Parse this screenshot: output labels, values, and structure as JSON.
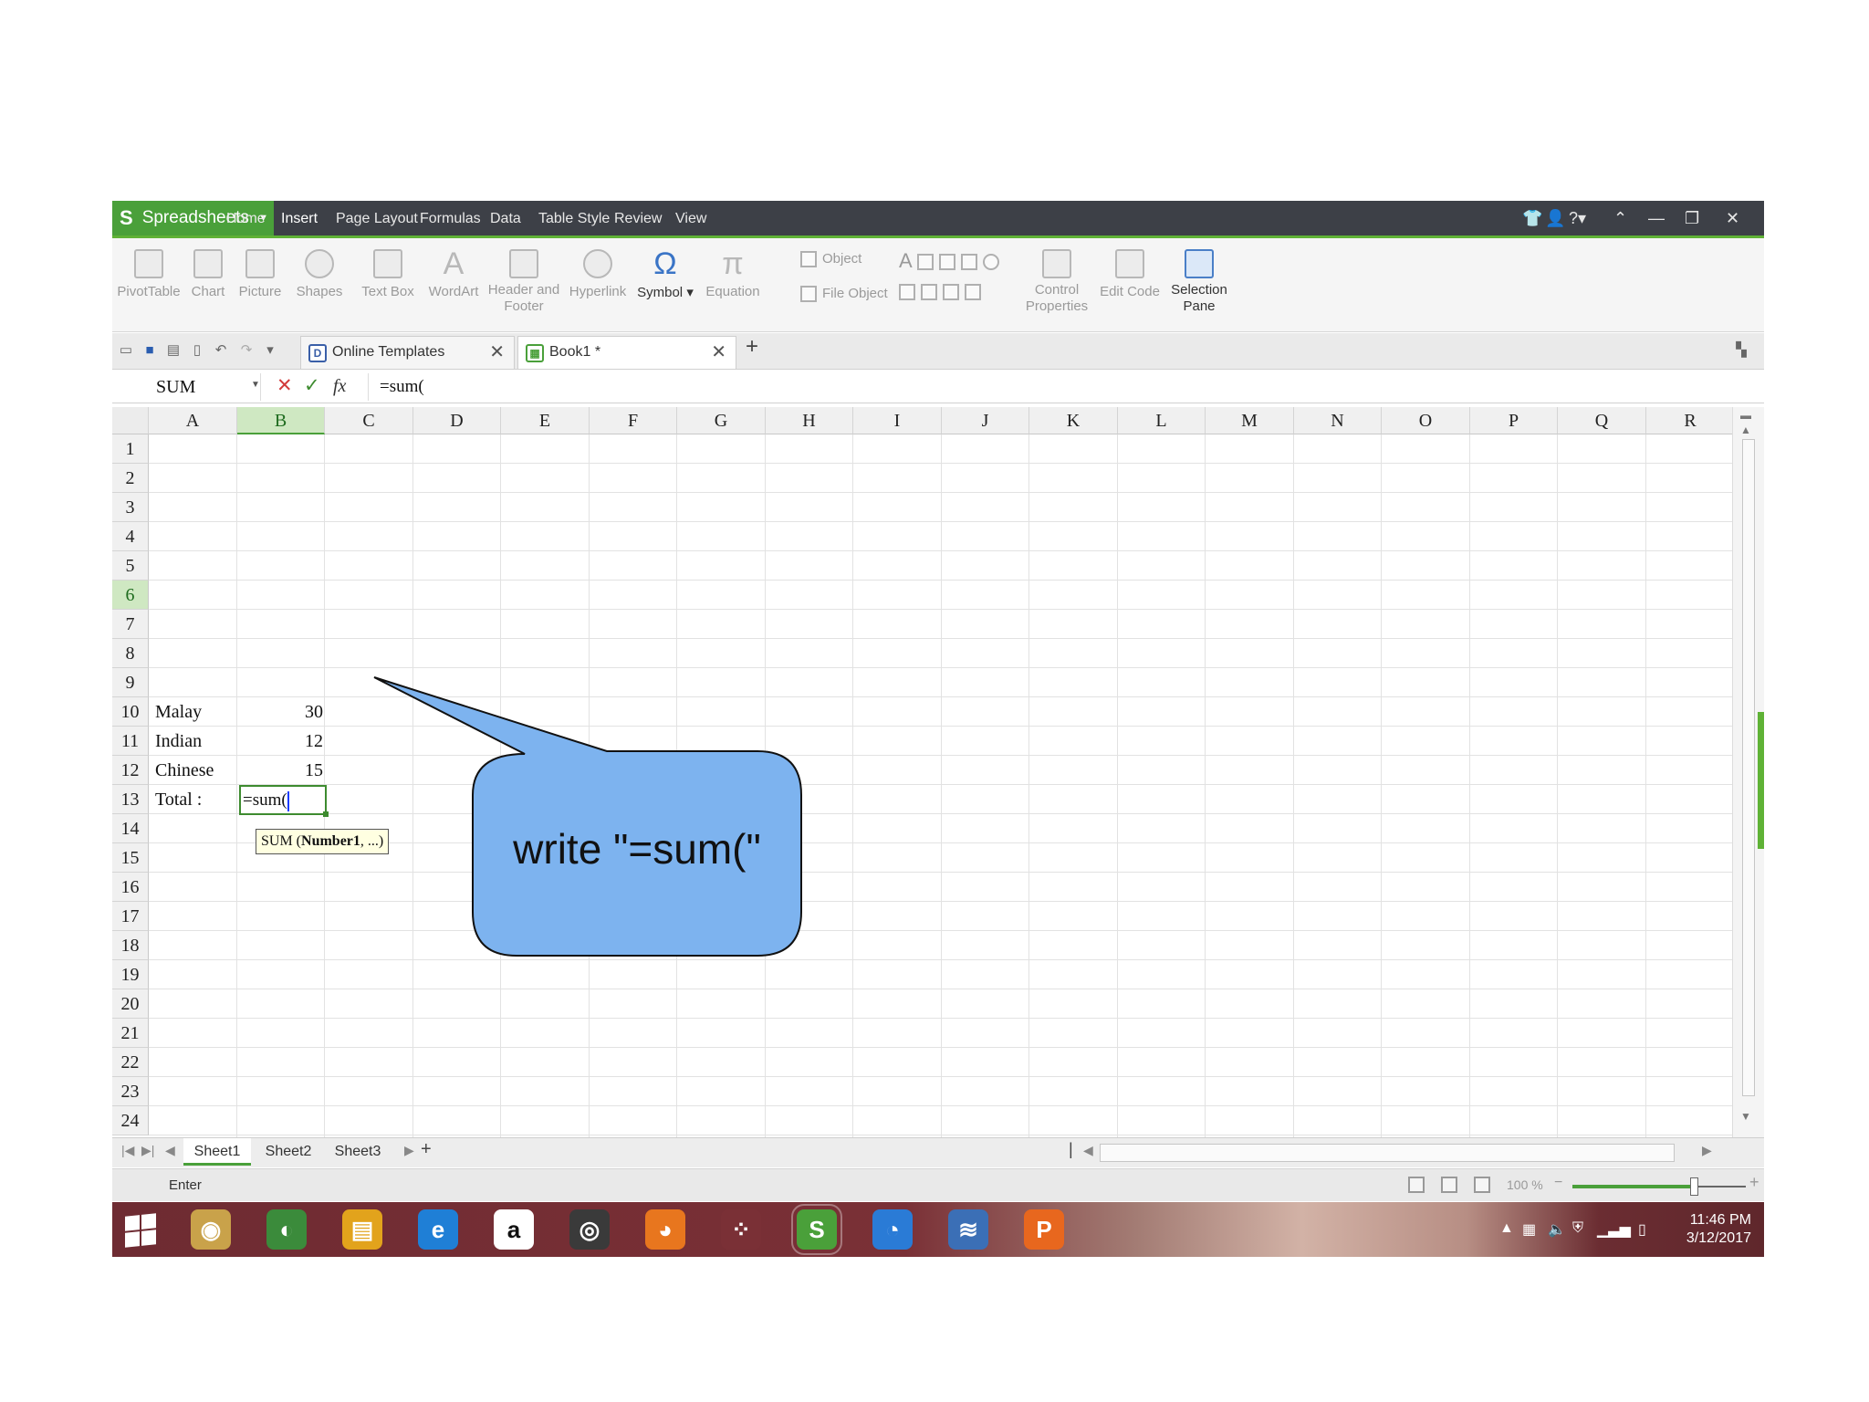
{
  "app": {
    "brand": "Spreadsheets",
    "menu": [
      "Home",
      "Insert",
      "Page Layout",
      "Formulas",
      "Data",
      "Table Style",
      "Review",
      "View"
    ],
    "active_menu": "Insert"
  },
  "ribbon": {
    "buttons": [
      {
        "label": "PivotTable"
      },
      {
        "label": "Chart"
      },
      {
        "label": "Picture"
      },
      {
        "label": "Shapes"
      },
      {
        "label": "Text Box"
      },
      {
        "label": "WordArt"
      },
      {
        "label": "Header and",
        "label2": "Footer"
      },
      {
        "label": "Hyperlink"
      },
      {
        "label": "Symbol"
      },
      {
        "label": "Equation"
      },
      {
        "label": "Control",
        "label2": "Properties"
      },
      {
        "label": "Edit Code"
      },
      {
        "label": "Selection",
        "label2": "Pane"
      }
    ],
    "object_label": "Object",
    "file_object_label": "File Object"
  },
  "tabs": {
    "online_templates": "Online Templates",
    "book": "Book1 *"
  },
  "formula_bar": {
    "name_box": "SUM",
    "fx": "fx",
    "formula": "=sum("
  },
  "grid": {
    "columns": [
      "A",
      "B",
      "C",
      "D",
      "E",
      "F",
      "G",
      "H",
      "I",
      "J",
      "K",
      "L",
      "M",
      "N",
      "O",
      "P",
      "Q",
      "R"
    ],
    "rows": [
      "1",
      "2",
      "3",
      "4",
      "5",
      "6",
      "7",
      "8",
      "9",
      "10",
      "11",
      "12",
      "13",
      "14",
      "15",
      "16",
      "17",
      "18",
      "19",
      "20",
      "21",
      "22",
      "23",
      "24"
    ],
    "cells": {
      "A3": "Malay",
      "B3": "30",
      "A4": "Indian",
      "B4": "12",
      "A5": "Chinese",
      "B5": "15",
      "A6": "Total :"
    },
    "active_cell_value": "=sum(",
    "tooltip_prefix": "SUM (",
    "tooltip_bold": "Number1",
    "tooltip_suffix": ", ...)"
  },
  "sheets": [
    "Sheet1",
    "Sheet2",
    "Sheet3"
  ],
  "status": {
    "mode": "Enter",
    "zoom": "100 %",
    "zoom_fraction": 0.7
  },
  "taskbar": {
    "time": "11:46 PM",
    "date": "3/12/2017",
    "apps": [
      {
        "name": "hdd-app-icon",
        "color": "#c9a24a",
        "glyph": "◉"
      },
      {
        "name": "chrome-icon",
        "color": "#3b8b3b",
        "glyph": "◐"
      },
      {
        "name": "notes-app-icon",
        "color": "#e2a31c",
        "glyph": "▤"
      },
      {
        "name": "internet-explorer-icon",
        "color": "#1f7fd6",
        "glyph": "e"
      },
      {
        "name": "amazon-icon",
        "color": "#ffffff",
        "glyph": "a"
      },
      {
        "name": "speaker-app-icon",
        "color": "#3a3a3a",
        "glyph": "◎"
      },
      {
        "name": "firefox-icon",
        "color": "#e8761e",
        "glyph": "◕"
      },
      {
        "name": "agoda-icon",
        "color": "#7a3036",
        "glyph": "⁘"
      },
      {
        "name": "spreadsheets-app-icon",
        "color": "#4aa03a",
        "glyph": "S"
      },
      {
        "name": "firefox-dev-icon",
        "color": "#2a7bd6",
        "glyph": "◔"
      },
      {
        "name": "wifi-app-icon",
        "color": "#3b6fb6",
        "glyph": "≋"
      },
      {
        "name": "presentation-app-icon",
        "color": "#e8671e",
        "glyph": "P"
      }
    ]
  },
  "callout": {
    "text": "write \"=sum(\"",
    "fill": "#7db3ef"
  },
  "colors": {
    "menubar": "#3d4047",
    "accent_green": "#4aa03a",
    "active_border": "#3d8b2f"
  }
}
